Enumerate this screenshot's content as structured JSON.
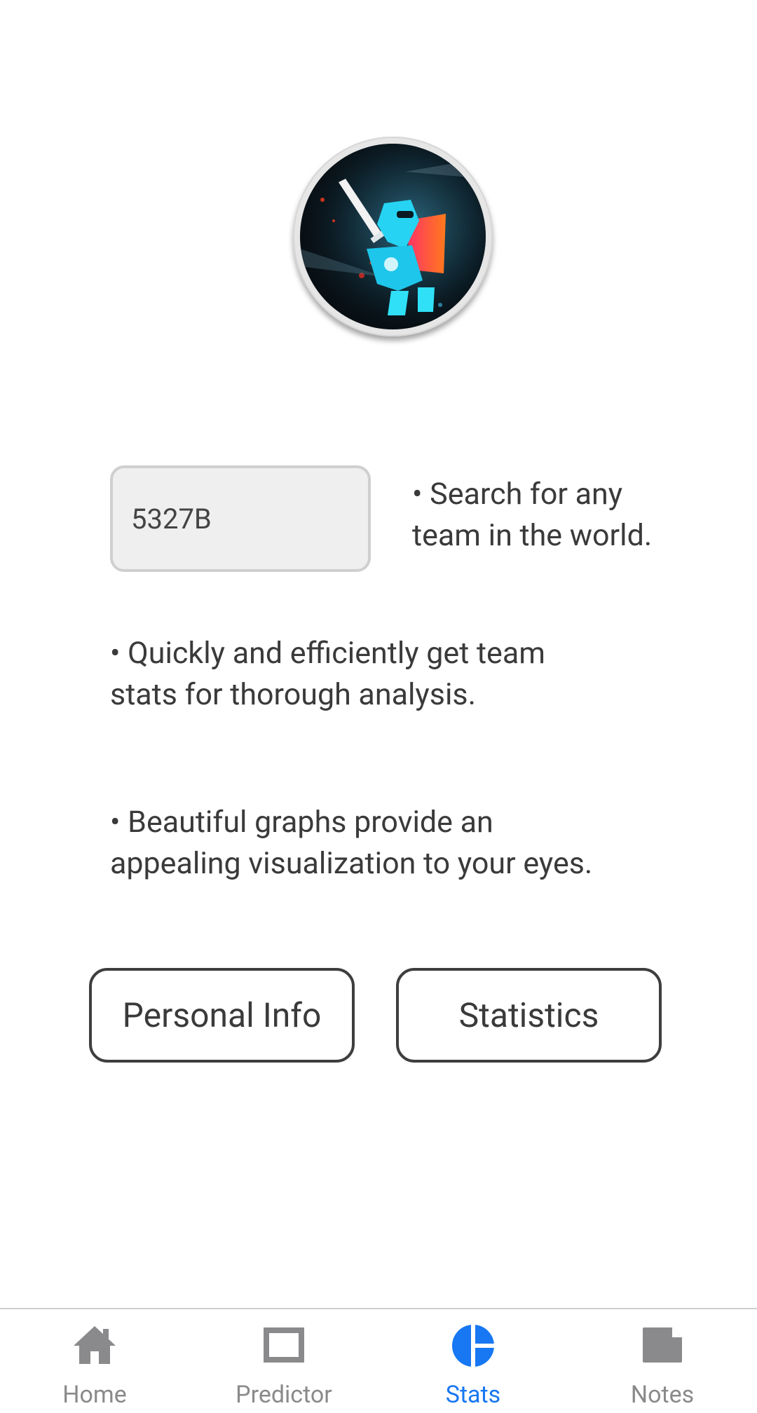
{
  "search": {
    "value": "5327B"
  },
  "features": {
    "search": [
      "• Search for any",
      "team in the world."
    ],
    "stats": [
      "• Quickly and efficiently get team",
      "stats for thorough analysis."
    ],
    "graphs": [
      "• Beautiful graphs provide an",
      "appealing visualization to your eyes."
    ]
  },
  "buttons": {
    "personal_info": "Personal Info",
    "statistics": "Statistics"
  },
  "nav": {
    "active": "Stats",
    "active_color": "#1877f2",
    "inactive_color": "#8a8a8c",
    "items": [
      {
        "label": "Home",
        "icon": "home-icon"
      },
      {
        "label": "Predictor",
        "icon": "predictor-icon"
      },
      {
        "label": "Stats",
        "icon": "pie-chart-icon"
      },
      {
        "label": "Notes",
        "icon": "notes-icon"
      }
    ]
  }
}
